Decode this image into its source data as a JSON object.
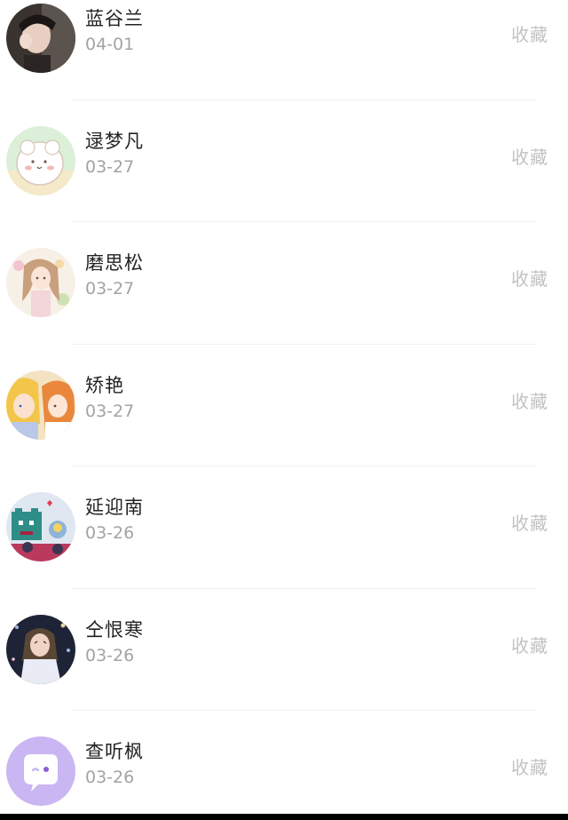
{
  "items": [
    {
      "name": "蓝谷兰",
      "date": "04-01",
      "action": "收藏",
      "avatar_icon": "dark-photo-avatar-icon"
    },
    {
      "name": "逯梦凡",
      "date": "03-27",
      "action": "收藏",
      "avatar_icon": "cartoon-sheep-avatar-icon"
    },
    {
      "name": "磨思松",
      "date": "03-27",
      "action": "收藏",
      "avatar_icon": "anime-girl-avatar-icon"
    },
    {
      "name": "矫艳",
      "date": "03-27",
      "action": "收藏",
      "avatar_icon": "anime-couple-avatar-icon"
    },
    {
      "name": "延迎南",
      "date": "03-26",
      "action": "收藏",
      "avatar_icon": "pixel-monster-avatar-icon"
    },
    {
      "name": "仝恨寒",
      "date": "03-26",
      "action": "收藏",
      "avatar_icon": "night-photo-avatar-icon"
    },
    {
      "name": "查听枫",
      "date": "03-26",
      "action": "收藏",
      "avatar_icon": "chat-bubble-avatar-icon"
    }
  ],
  "colors": {
    "name_text": "#222222",
    "date_text": "#a3a3a3",
    "action_text": "#c2c2c2",
    "divider": "#f1f1f1",
    "chat_avatar_bg": "#c9b6f2"
  }
}
